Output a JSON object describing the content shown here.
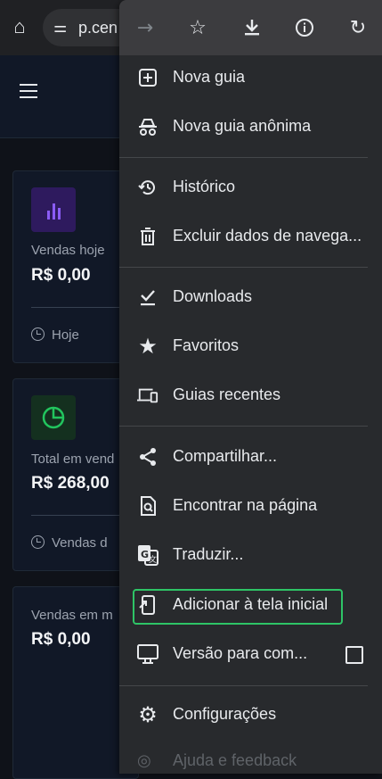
{
  "browser": {
    "url_fragment": "p.cen",
    "site_info_symbol": "⚌"
  },
  "app": {
    "cards": [
      {
        "label": "Vendas hoje",
        "value": "R$ 0,00",
        "footer": "Hoje",
        "icon": "bar-chart-icon",
        "accent": "#7c3aed"
      },
      {
        "label": "Total em vend",
        "value": "R$ 268,00",
        "footer": "Vendas d",
        "icon": "pie-chart-icon",
        "accent": "#22c55e"
      },
      {
        "label": "Vendas em m",
        "value": "R$ 0,00"
      }
    ]
  },
  "menu": {
    "toolbar": [
      "forward-icon",
      "star-icon",
      "download-icon",
      "info-icon",
      "reload-icon"
    ],
    "items": [
      {
        "label": "Nova guia",
        "icon": "new-tab-icon"
      },
      {
        "label": "Nova guia anônima",
        "icon": "incognito-icon"
      },
      {
        "label": "Histórico",
        "icon": "history-icon"
      },
      {
        "label": "Excluir dados de navega...",
        "icon": "trash-icon"
      },
      {
        "label": "Downloads",
        "icon": "downloads-icon"
      },
      {
        "label": "Favoritos",
        "icon": "star-filled-icon"
      },
      {
        "label": "Guias recentes",
        "icon": "devices-icon"
      },
      {
        "label": "Compartilhar...",
        "icon": "share-icon"
      },
      {
        "label": "Encontrar na página",
        "icon": "find-in-page-icon"
      },
      {
        "label": "Traduzir...",
        "icon": "translate-icon"
      },
      {
        "label": "Adicionar à tela inicial",
        "icon": "add-to-home-icon",
        "highlight_color": "#2ec466"
      },
      {
        "label": "Versão para com...",
        "icon": "desktop-icon",
        "checked": false
      },
      {
        "label": "Configurações",
        "icon": "gear-icon"
      },
      {
        "label": "Ajuda e feedback",
        "icon": "help-icon"
      }
    ]
  }
}
